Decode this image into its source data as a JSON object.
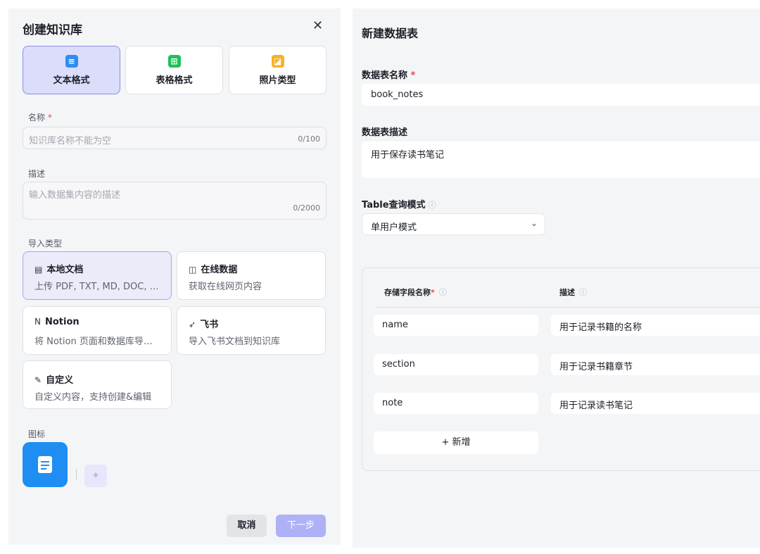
{
  "left": {
    "title": "创建知识库",
    "close_glyph": "✕",
    "formats": [
      {
        "label": "文本格式",
        "icon": "text-doc-icon",
        "color": "#2f8cf2"
      },
      {
        "label": "表格格式",
        "icon": "table-grid-icon",
        "color": "#20c05c"
      },
      {
        "label": "照片类型",
        "icon": "photo-icon",
        "color": "#f5b325"
      }
    ],
    "name_label": "名称",
    "name_placeholder": "知识库名称不能为空",
    "name_count": "0/100",
    "desc_label": "描述",
    "desc_placeholder": "输入数据集内容的描述",
    "desc_count": "0/2000",
    "import_label": "导入类型",
    "imports": [
      {
        "title": "本地文档",
        "desc": "上传 PDF, TXT, MD, DOC, …",
        "icon": "local-doc-icon"
      },
      {
        "title": "在线数据",
        "desc": "获取在线网页内容",
        "icon": "web-data-icon"
      },
      {
        "title": "Notion",
        "desc": "将 Notion 页面和数据库导…",
        "icon": "notion-icon"
      },
      {
        "title": "飞书",
        "desc": "导入飞书文档到知识库",
        "icon": "feishu-icon"
      },
      {
        "title": "自定义",
        "desc": "自定义内容，支持创建&编辑",
        "icon": "custom-edit-icon"
      }
    ],
    "icon_label": "图标",
    "cancel_label": "取消",
    "next_label": "下一步"
  },
  "right": {
    "title": "新建数据表",
    "table_name_label": "数据表名称",
    "table_name_value": "book_notes",
    "table_desc_label": "数据表描述",
    "table_desc_value": "用于保存读书笔记",
    "query_mode_label": "Table查询模式",
    "query_mode_value": "单用户模式",
    "col_field_label": "存储字段名称",
    "col_desc_label": "描述",
    "fields": [
      {
        "name": "name",
        "desc": "用于记录书籍的名称"
      },
      {
        "name": "section",
        "desc": "用于记录书籍章节"
      },
      {
        "name": "note",
        "desc": "用于记录读书笔记"
      }
    ],
    "add_label": "+ 新增"
  },
  "colors": {
    "accent": "#6b70e8",
    "selected_bg": "#dcdcfb",
    "next_btn": "#aeb1f5",
    "required": "#e5484d"
  }
}
